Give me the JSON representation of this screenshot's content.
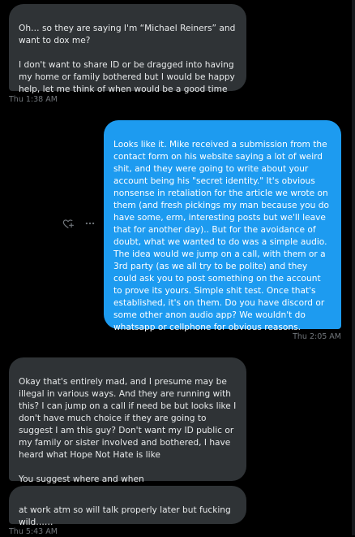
{
  "messages": [
    {
      "direction": "incoming",
      "text": "Oh… so they are saying I'm “Michael Reiners” and want to dox me?\n\nI don't want to share ID or be dragged into having my home or family bothered but I would be happy help, let me think of when would be a good time",
      "timestamp": "Thu 1:38 AM"
    },
    {
      "direction": "outgoing",
      "text": "Looks like it. Mike received a submission from the contact form on his website saying a lot of weird shit, and they were going to write about your account being his \"secret identity.\" It's obvious nonsense in retaliation for the article we wrote on them (and fresh pickings my man because you do have some, erm, interesting posts but we'll leave that for another day).. But for the avoidance of doubt, what we wanted to do was a simple audio. The idea would we jump on a call, with them or a 3rd party (as we all try to be polite) and they could ask you to post something on the account to prove its yours. Simple shit test. Once that's established, it's on them. Do you have discord or some other anon audio app? We wouldn't do whatsapp or cellphone for obvious reasons.",
      "timestamp": "Thu 2:05 AM"
    },
    {
      "direction": "incoming",
      "text": "Okay that's entirely mad, and I presume may be illegal in various ways. And they are running with this? I can jump on a call if need be but looks like I don't have much choice if they are going to suggest I am this guy? Don't want my ID public or my family or sister involved and bothered, I have heard what Hope Not Hate is like\n\nYou suggest where and when"
    },
    {
      "direction": "incoming",
      "text": "at work atm so will talk properly later but fucking wild……",
      "timestamp": "Thu 5:43 AM"
    }
  ],
  "icons": {
    "react": "heart-plus-icon",
    "more": "more-horizontal-icon"
  },
  "colors": {
    "background": "#000000",
    "incoming_bubble": "#2f3336",
    "outgoing_bubble": "#1d9bf0",
    "timestamp": "#71767b"
  }
}
